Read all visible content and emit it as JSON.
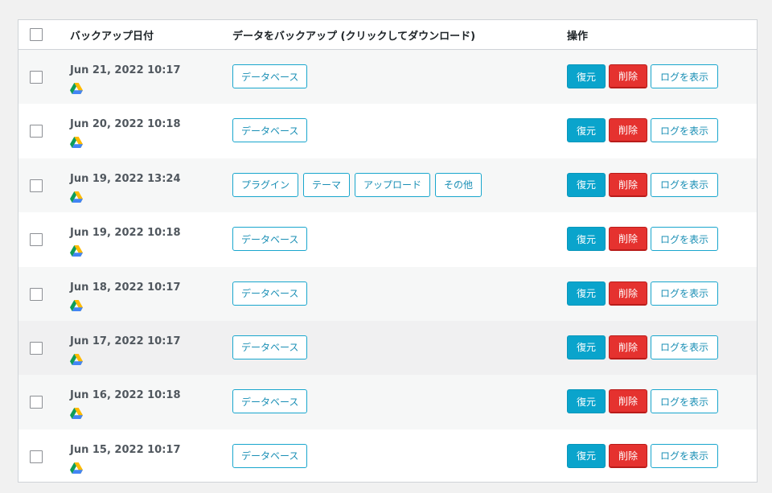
{
  "colors": {
    "accent": "#0aa4cc",
    "danger": "#e5322f",
    "text": "#50575e"
  },
  "header": {
    "date_label": "バックアップ日付",
    "data_label": "データをバックアップ (クリックしてダウンロード)",
    "actions_label": "操作"
  },
  "actions": {
    "restore": "復元",
    "delete": "削除",
    "view_log": "ログを表示"
  },
  "storage_icon": "google-drive-icon",
  "rows": [
    {
      "date": "Jun 21, 2022 10:17",
      "items": [
        "データベース"
      ]
    },
    {
      "date": "Jun 20, 2022 10:18",
      "items": [
        "データベース"
      ]
    },
    {
      "date": "Jun 19, 2022 13:24",
      "items": [
        "プラグイン",
        "テーマ",
        "アップロード",
        "その他"
      ]
    },
    {
      "date": "Jun 19, 2022 10:18",
      "items": [
        "データベース"
      ]
    },
    {
      "date": "Jun 18, 2022 10:17",
      "items": [
        "データベース"
      ]
    },
    {
      "date": "Jun 17, 2022 10:17",
      "items": [
        "データベース"
      ]
    },
    {
      "date": "Jun 16, 2022 10:18",
      "items": [
        "データベース"
      ]
    },
    {
      "date": "Jun 15, 2022 10:17",
      "items": [
        "データベース"
      ]
    }
  ]
}
